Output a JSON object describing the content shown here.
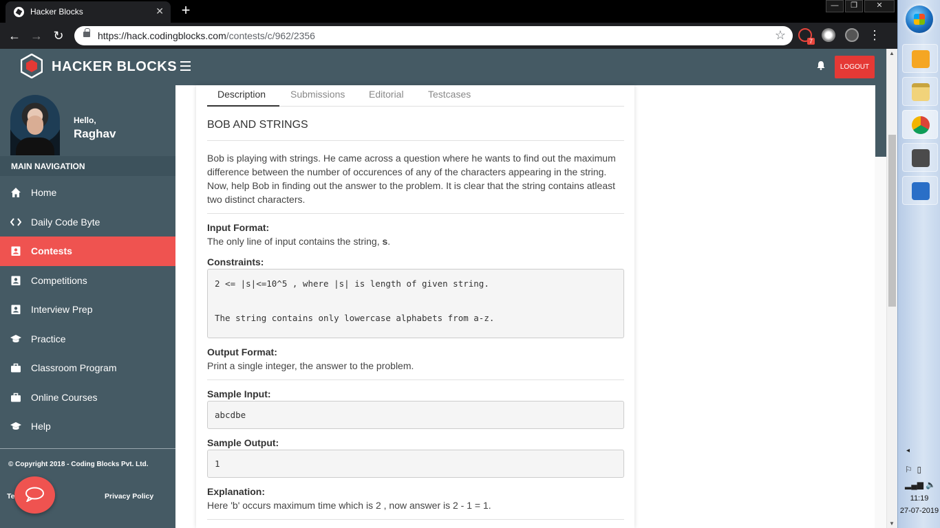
{
  "browser": {
    "tab_title": "Hacker Blocks",
    "tab_close": "✕",
    "new_tab": "+",
    "url_host": "https://hack.codingblocks.com",
    "url_path": "/contests/c/962/2356",
    "extension_badge": "7",
    "window_controls": [
      "—",
      "❐",
      "✕"
    ]
  },
  "header": {
    "brand": "HACKER BLOCKS",
    "logout_label": "LOGOUT"
  },
  "sidebar": {
    "greeting": "Hello,",
    "user_name": "Raghav",
    "nav_heading": "MAIN NAVIGATION",
    "items": [
      {
        "label": "Home",
        "icon": "home-icon",
        "active": false
      },
      {
        "label": "Daily Code Byte",
        "icon": "code-icon",
        "active": false
      },
      {
        "label": "Contests",
        "icon": "contact-badge-icon",
        "active": true
      },
      {
        "label": "Competitions",
        "icon": "contact-badge-icon",
        "active": false
      },
      {
        "label": "Interview Prep",
        "icon": "contact-badge-icon",
        "active": false
      },
      {
        "label": "Practice",
        "icon": "graduation-cap-icon",
        "active": false
      },
      {
        "label": "Classroom Program",
        "icon": "briefcase-icon",
        "active": false
      },
      {
        "label": "Online Courses",
        "icon": "briefcase-icon",
        "active": false
      },
      {
        "label": "Help",
        "icon": "graduation-cap-icon",
        "active": false
      }
    ],
    "copyright": "© Copyright 2018 - Coding Blocks Pvt. Ltd.",
    "terms_link": "Te        vice",
    "privacy_link": "Privacy Policy"
  },
  "problem": {
    "tabs": [
      "Description",
      "Submissions",
      "Editorial",
      "Testcases"
    ],
    "active_tab": "Description",
    "title": "BOB AND STRINGS",
    "description": "Bob is playing with strings. He came across a question where he wants to find out the maximum difference between the number of occurences of any of the characters appearing in the string. Now, help Bob in finding out the answer to the problem. It is clear that the string contains atleast two distinct characters.",
    "input_format_label": "Input Format:",
    "input_format_text": "The only line of input contains the string, ",
    "input_format_var": "s",
    "input_format_end": ".",
    "constraints_label": "Constraints:",
    "constraints": [
      "2 <= |s|<=10^5 , where |s| is length of given string.",
      "The string contains only lowercase alphabets from a-z."
    ],
    "output_format_label": "Output Format:",
    "output_format_text": "Print a single integer, the answer to the problem.",
    "sample_input_label": "Sample Input:",
    "sample_input": "abcdbe",
    "sample_output_label": "Sample Output:",
    "sample_output": "1",
    "explanation_label": "Explanation:",
    "explanation_text": "Here 'b' occurs maximum time which is 2 , now answer is 2 - 1 = 1."
  },
  "taskbar": {
    "time": "11:19",
    "date": "27-07-2019"
  },
  "colors": {
    "sidebar_bg": "#455a64",
    "active_nav": "#ef5350",
    "logout_bg": "#e53935"
  }
}
